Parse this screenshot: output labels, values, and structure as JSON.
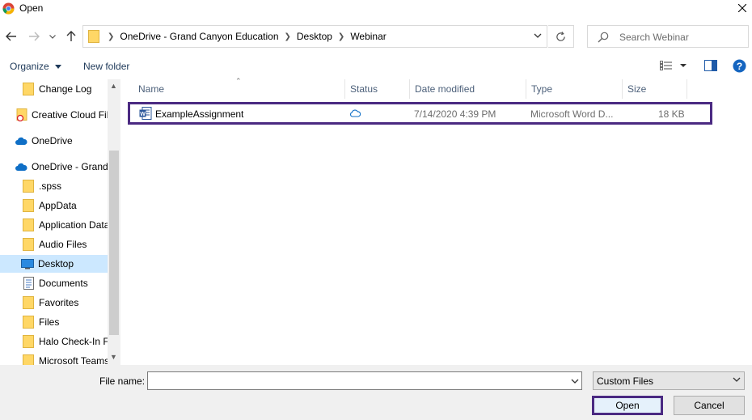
{
  "window": {
    "title": "Open"
  },
  "address": {
    "crumbs": [
      "OneDrive - Grand Canyon Education",
      "Desktop",
      "Webinar"
    ]
  },
  "search": {
    "placeholder": "Search Webinar"
  },
  "toolbar": {
    "organize": "Organize",
    "new_folder": "New folder"
  },
  "nav": {
    "items": [
      {
        "label": "Change Log",
        "icon": "folder-icon"
      },
      {
        "label": "Creative Cloud Fil",
        "icon": "creative-cloud-folder-icon"
      },
      {
        "label": "OneDrive",
        "icon": "cloud-icon"
      },
      {
        "label": "OneDrive - Grand",
        "icon": "cloud-icon"
      },
      {
        "label": ".spss",
        "icon": "folder-icon"
      },
      {
        "label": "AppData",
        "icon": "folder-icon"
      },
      {
        "label": "Application Data",
        "icon": "folder-icon"
      },
      {
        "label": "Audio Files",
        "icon": "folder-icon"
      },
      {
        "label": "Desktop",
        "icon": "desktop-icon"
      },
      {
        "label": "Documents",
        "icon": "documents-icon"
      },
      {
        "label": "Favorites",
        "icon": "folder-icon"
      },
      {
        "label": "Files",
        "icon": "folder-icon"
      },
      {
        "label": "Halo Check-In F",
        "icon": "folder-icon"
      },
      {
        "label": "Microsoft Teams",
        "icon": "folder-icon"
      }
    ]
  },
  "columns": {
    "name": "Name",
    "status": "Status",
    "date": "Date modified",
    "type": "Type",
    "size": "Size"
  },
  "files": [
    {
      "name": "ExampleAssignment",
      "status": "cloud-icon",
      "date": "7/14/2020 4:39 PM",
      "type": "Microsoft Word D...",
      "size": "18 KB"
    }
  ],
  "bottom": {
    "file_name_label": "File name:",
    "file_name_value": "",
    "filter": "Custom Files",
    "open": "Open",
    "cancel": "Cancel"
  },
  "colors": {
    "highlight": "#4b2a82",
    "folder": "#ffd766",
    "cloud": "#0f6fc6",
    "selected": "#cce8ff"
  }
}
